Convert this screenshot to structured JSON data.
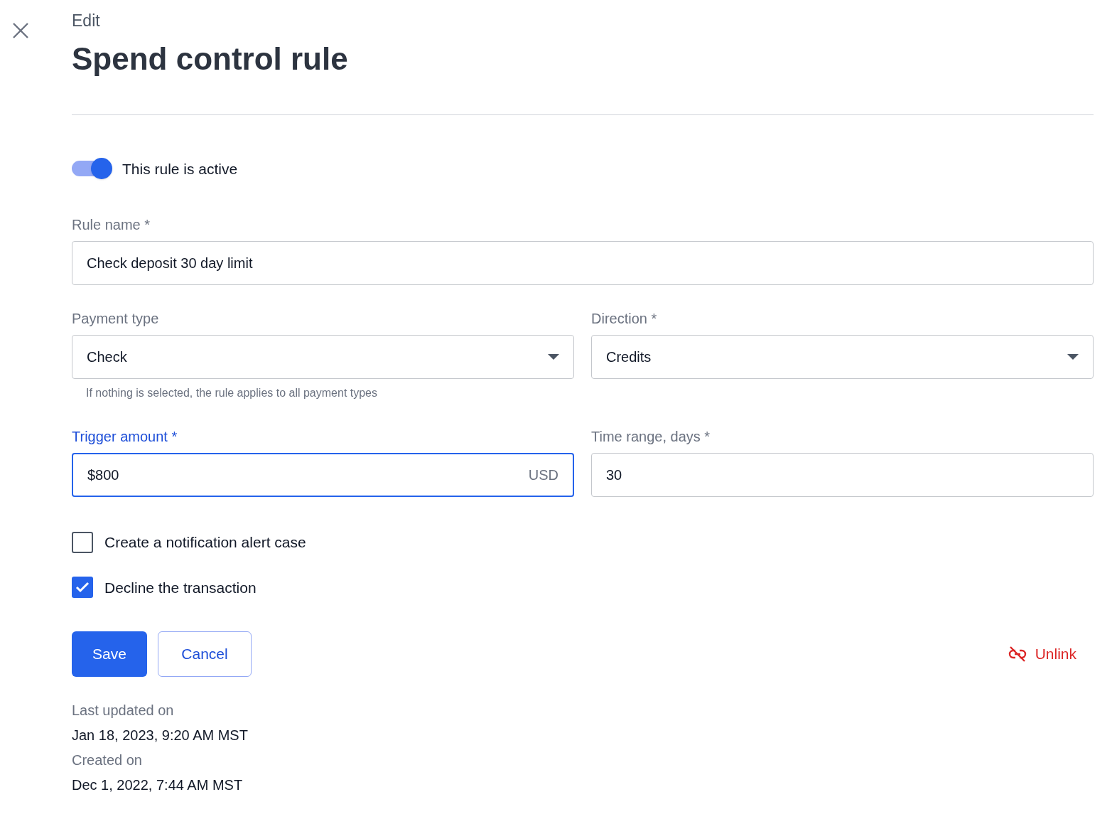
{
  "header": {
    "eyebrow": "Edit",
    "title": "Spend control rule"
  },
  "active_toggle": {
    "label": "This rule is active",
    "on": true
  },
  "rule_name": {
    "label": "Rule name *",
    "value": "Check deposit 30 day limit",
    "focused": false
  },
  "payment_type": {
    "label": "Payment type",
    "value": "Check",
    "helper": "If nothing is selected, the rule applies to all payment types"
  },
  "direction": {
    "label": "Direction *",
    "value": "Credits"
  },
  "trigger_amount": {
    "label": "Trigger amount *",
    "value": "$800",
    "suffix": "USD",
    "focused": true
  },
  "time_range": {
    "label": "Time range, days *",
    "value": "30",
    "focused": false
  },
  "options": [
    {
      "label": "Create a notification alert case",
      "checked": false
    },
    {
      "label": "Decline the transaction",
      "checked": true
    }
  ],
  "buttons": {
    "save": "Save",
    "cancel": "Cancel",
    "unlink": "Unlink"
  },
  "meta": [
    {
      "label": "Last updated on",
      "value": "Jan 18, 2023, 9:20 AM MST"
    },
    {
      "label": "Created on",
      "value": "Dec 1, 2022, 7:44 AM MST"
    }
  ]
}
